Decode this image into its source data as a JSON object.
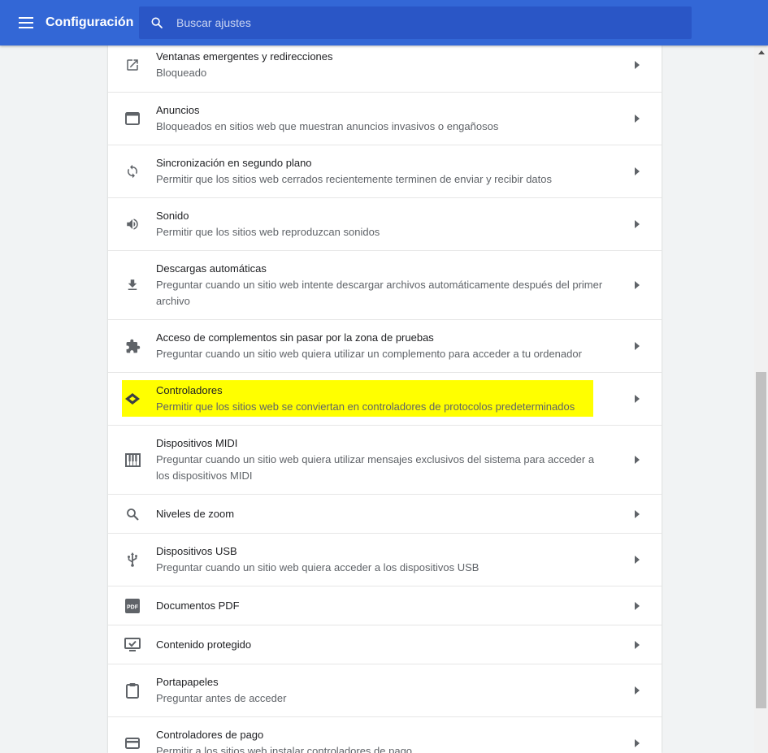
{
  "header": {
    "title": "Configuración",
    "search_placeholder": "Buscar ajustes",
    "bar_color": "#3367d6"
  },
  "rows": [
    {
      "icon": "open-in-new-icon",
      "title": "Ventanas emergentes y redirecciones",
      "desc": "Bloqueado"
    },
    {
      "icon": "web-asset-icon",
      "title": "Anuncios",
      "desc": "Bloqueados en sitios web que muestran anuncios invasivos o engañosos"
    },
    {
      "icon": "sync-icon",
      "title": "Sincronización en segundo plano",
      "desc": "Permitir que los sitios web cerrados recientemente terminen de enviar y recibir datos"
    },
    {
      "icon": "volume-icon",
      "title": "Sonido",
      "desc": "Permitir que los sitios web reproduzcan sonidos"
    },
    {
      "icon": "download-icon",
      "title": "Descargas automáticas",
      "desc1": "Preguntar cuando un sitio web intente descargar archivos automáticamente después del primer",
      "desc2": "archivo"
    },
    {
      "icon": "puzzle-icon",
      "title": "Acceso de complementos sin pasar por la zona de pruebas",
      "desc": "Preguntar cuando un sitio web quiera utilizar un complemento para acceder a tu ordenador"
    },
    {
      "icon": "handler-icon",
      "title": "Controladores",
      "desc": "Permitir que los sitios web se conviertan en controladores de protocolos predeterminados",
      "highlight_color": "#ffff00"
    },
    {
      "icon": "piano-icon",
      "title": "Dispositivos MIDI",
      "desc1": "Preguntar cuando un sitio web quiera utilizar mensajes exclusivos del sistema para acceder a",
      "desc2": "los dispositivos MIDI"
    },
    {
      "icon": "zoom-icon",
      "title": "Niveles de zoom"
    },
    {
      "icon": "usb-icon",
      "title": "Dispositivos USB",
      "desc": "Preguntar cuando un sitio web quiera acceder a los dispositivos USB"
    },
    {
      "icon": "pdf-icon",
      "title": "Documentos PDF",
      "pdf_label": "PDF"
    },
    {
      "icon": "protected-content-icon",
      "title": "Contenido protegido"
    },
    {
      "icon": "clipboard-icon",
      "title": "Portapapeles",
      "desc": "Preguntar antes de acceder"
    },
    {
      "icon": "credit-card-icon",
      "title": "Controladores de pago",
      "desc": "Permitir a los sitios web instalar controladores de pago"
    }
  ]
}
